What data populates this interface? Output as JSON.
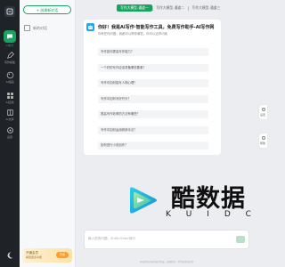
{
  "rail": {
    "items": [
      {
        "label": "AI聊天",
        "icon": "chat-icon"
      },
      {
        "label": "写作模板",
        "icon": "edit-icon"
      },
      {
        "label": "AI绘画",
        "icon": "palette-icon"
      },
      {
        "label": "AI应用",
        "icon": "apps-icon"
      },
      {
        "label": "AI文库",
        "icon": "book-icon"
      },
      {
        "label": "设置",
        "icon": "gear-icon"
      }
    ]
  },
  "panel": {
    "new_chat_label": "+ 创建新对话",
    "history_label": "新的对话"
  },
  "vip": {
    "title": "开通会员",
    "subtitle": "解锁更多功能",
    "button_label": "开通"
  },
  "tabs": [
    {
      "label": "写作大模型-通道一",
      "active": true
    },
    {
      "label": "写作大模型-通道二",
      "active": false
    },
    {
      "label": "写作大模型-通道三",
      "active": false
    }
  ],
  "welcome": {
    "headline": "你好！我是AI写作·智能写作工具，免费写作助手-AI写作网",
    "subline": "你有任何问题，我都可以帮你解答，你可以这样问我"
  },
  "questions": [
    "写作如何提高写作能力？",
    "一个好的写作应该具备哪些要素？",
    "写作中如何描写人物心理？",
    "写作中如何写好开头？",
    "提高写作效率的方法有哪些？",
    "写作中如何运用修辞手法？",
    "如何进行小说创作？"
  ],
  "side_buttons": [
    {
      "label": "设置",
      "icon": "settings-icon"
    },
    {
      "label": "帮助",
      "icon": "help-icon"
    }
  ],
  "input": {
    "placeholder": "输入您的问题，Shift+Enter换行",
    "send_icon": "send-icon"
  },
  "footer": "本站所有内容均由AI生成，仅供参考，不代表本站立场",
  "watermark": {
    "text": "酷数据",
    "sub": [
      "K",
      "U",
      "I",
      "D",
      "C"
    ]
  },
  "colors": {
    "accent": "#1aa260",
    "rail_bg": "#1f2328",
    "page_bg": "#ecedf0"
  }
}
